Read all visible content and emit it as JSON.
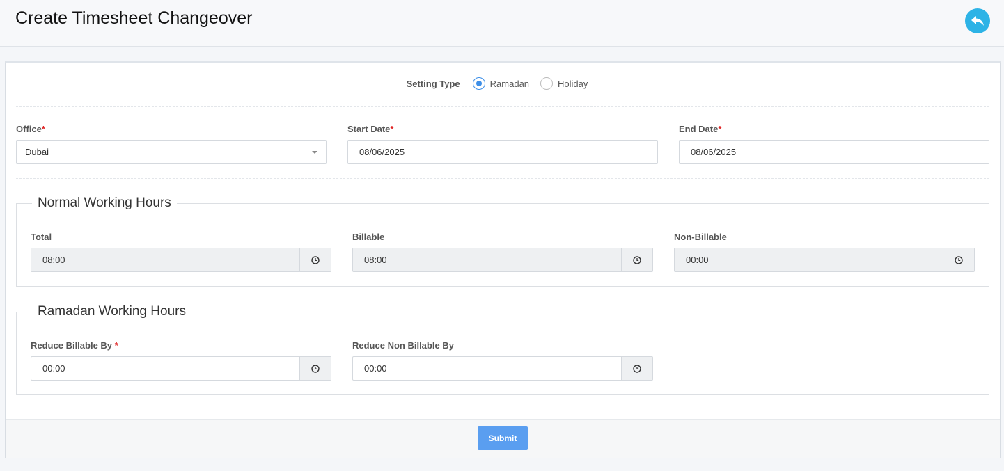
{
  "header": {
    "title": "Create Timesheet Changeover",
    "back_icon": "reply-icon"
  },
  "setting_type": {
    "label": "Setting Type",
    "options": [
      {
        "label": "Ramadan",
        "selected": true
      },
      {
        "label": "Holiday",
        "selected": false
      }
    ]
  },
  "fields": {
    "office": {
      "label": "Office",
      "required_mark": "*",
      "value": "Dubai"
    },
    "start_date": {
      "label": "Start Date",
      "required_mark": "*",
      "value": "08/06/2025"
    },
    "end_date": {
      "label": "End Date",
      "required_mark": "*",
      "value": "08/06/2025"
    }
  },
  "normal_hours": {
    "legend": "Normal Working Hours",
    "total": {
      "label": "Total",
      "value": "08:00"
    },
    "billable": {
      "label": "Billable",
      "value": "08:00"
    },
    "non_billable": {
      "label": "Non-Billable",
      "value": "00:00"
    }
  },
  "ramadan_hours": {
    "legend": "Ramadan Working Hours",
    "reduce_billable": {
      "label": "Reduce Billable By",
      "required_mark": "*",
      "value": "00:00"
    },
    "reduce_non_billable": {
      "label": "Reduce Non Billable By",
      "value": "00:00"
    }
  },
  "footer": {
    "submit_label": "Submit"
  },
  "colors": {
    "accent": "#2db3e6",
    "primary_button": "#5a9ef0",
    "radio": "#3d8fe8",
    "required": "#e02424"
  }
}
